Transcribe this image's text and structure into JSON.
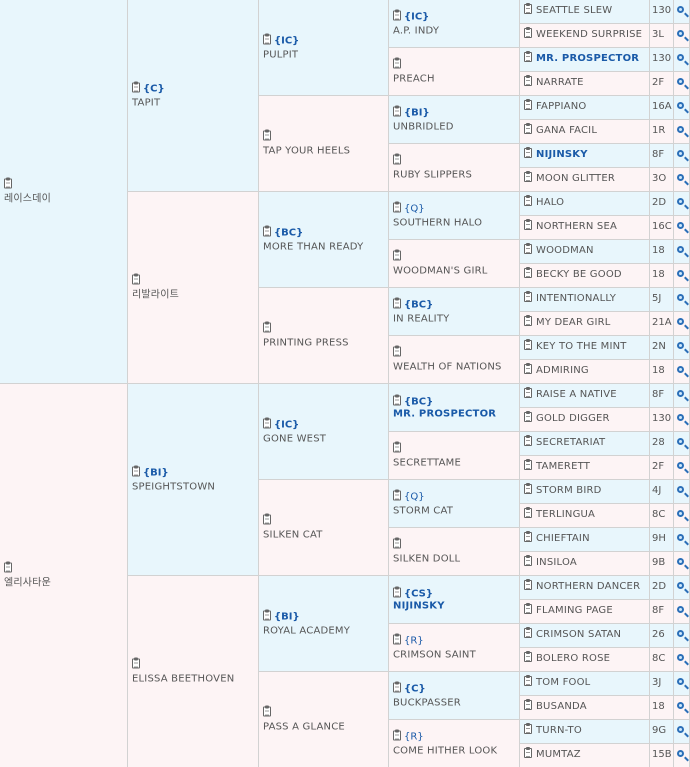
{
  "pedigree": {
    "generations": [
      [
        {
          "name": "레이스데이",
          "tag": ""
        },
        {
          "name": "엘리사타운",
          "tag": ""
        }
      ],
      [
        {
          "name": "TAPIT",
          "tag": "{C}"
        },
        {
          "name": "리발라이트",
          "tag": ""
        },
        {
          "name": "SPEIGHTSTOWN",
          "tag": "{BI}"
        },
        {
          "name": "ELISSA BEETHOVEN",
          "tag": ""
        }
      ],
      [
        {
          "name": "PULPIT",
          "tag": "{IC}"
        },
        {
          "name": "TAP YOUR HEELS",
          "tag": ""
        },
        {
          "name": "MORE THAN READY",
          "tag": "{BC}"
        },
        {
          "name": "PRINTING PRESS",
          "tag": ""
        },
        {
          "name": "GONE WEST",
          "tag": "{IC}"
        },
        {
          "name": "SILKEN CAT",
          "tag": ""
        },
        {
          "name": "ROYAL ACADEMY",
          "tag": "{BI}"
        },
        {
          "name": "PASS A GLANCE",
          "tag": ""
        }
      ],
      [
        {
          "name": "A.P. INDY",
          "tag": "{IC}"
        },
        {
          "name": "PREACH",
          "tag": ""
        },
        {
          "name": "UNBRIDLED",
          "tag": "{BI}"
        },
        {
          "name": "RUBY SLIPPERS",
          "tag": ""
        },
        {
          "name": "SOUTHERN HALO",
          "tag": "{Q}"
        },
        {
          "name": "WOODMAN'S GIRL",
          "tag": ""
        },
        {
          "name": "IN REALITY",
          "tag": "{BC}"
        },
        {
          "name": "WEALTH OF NATIONS",
          "tag": ""
        },
        {
          "name": "MR. PROSPECTOR",
          "tag": "{BC}",
          "highlight": true
        },
        {
          "name": "SECRETTAME",
          "tag": ""
        },
        {
          "name": "STORM CAT",
          "tag": "{Q}"
        },
        {
          "name": "SILKEN DOLL",
          "tag": ""
        },
        {
          "name": "NIJINSKY",
          "tag": "{CS}",
          "highlight": true
        },
        {
          "name": "CRIMSON SAINT",
          "tag": "{R}"
        },
        {
          "name": "BUCKPASSER",
          "tag": "{C}"
        },
        {
          "name": "COME HITHER LOOK",
          "tag": "{R}"
        }
      ],
      [
        {
          "name": "SEATTLE SLEW",
          "num": "130"
        },
        {
          "name": "WEEKEND SURPRISE",
          "num": "3L"
        },
        {
          "name": "MR. PROSPECTOR",
          "num": "130",
          "highlight": true
        },
        {
          "name": "NARRATE",
          "num": "2F"
        },
        {
          "name": "FAPPIANO",
          "num": "16A"
        },
        {
          "name": "GANA FACIL",
          "num": "1R"
        },
        {
          "name": "NIJINSKY",
          "num": "8F",
          "highlight": true
        },
        {
          "name": "MOON GLITTER",
          "num": "3O"
        },
        {
          "name": "HALO",
          "num": "2D"
        },
        {
          "name": "NORTHERN SEA",
          "num": "16C"
        },
        {
          "name": "WOODMAN",
          "num": "18"
        },
        {
          "name": "BECKY BE GOOD",
          "num": "18"
        },
        {
          "name": "INTENTIONALLY",
          "num": "5J"
        },
        {
          "name": "MY DEAR GIRL",
          "num": "21A"
        },
        {
          "name": "KEY TO THE MINT",
          "num": "2N"
        },
        {
          "name": "ADMIRING",
          "num": "18"
        },
        {
          "name": "RAISE A NATIVE",
          "num": "8F"
        },
        {
          "name": "GOLD DIGGER",
          "num": "130"
        },
        {
          "name": "SECRETARIAT",
          "num": "28"
        },
        {
          "name": "TAMERETT",
          "num": "2F"
        },
        {
          "name": "STORM BIRD",
          "num": "4J"
        },
        {
          "name": "TERLINGUA",
          "num": "8C"
        },
        {
          "name": "CHIEFTAIN",
          "num": "9H"
        },
        {
          "name": "INSILOA",
          "num": "9B"
        },
        {
          "name": "NORTHERN DANCER",
          "num": "2D"
        },
        {
          "name": "FLAMING PAGE",
          "num": "8F"
        },
        {
          "name": "CRIMSON SATAN",
          "num": "26"
        },
        {
          "name": "BOLERO ROSE",
          "num": "8C"
        },
        {
          "name": "TOM FOOL",
          "num": "3J"
        },
        {
          "name": "BUSANDA",
          "num": "18"
        },
        {
          "name": "TURN-TO",
          "num": "9G"
        },
        {
          "name": "MUMTAZ",
          "num": "15B"
        }
      ]
    ],
    "colors": {
      "male": "#e8f6fc",
      "female": "#fdf4f5",
      "link": "#1a5aa8"
    }
  }
}
